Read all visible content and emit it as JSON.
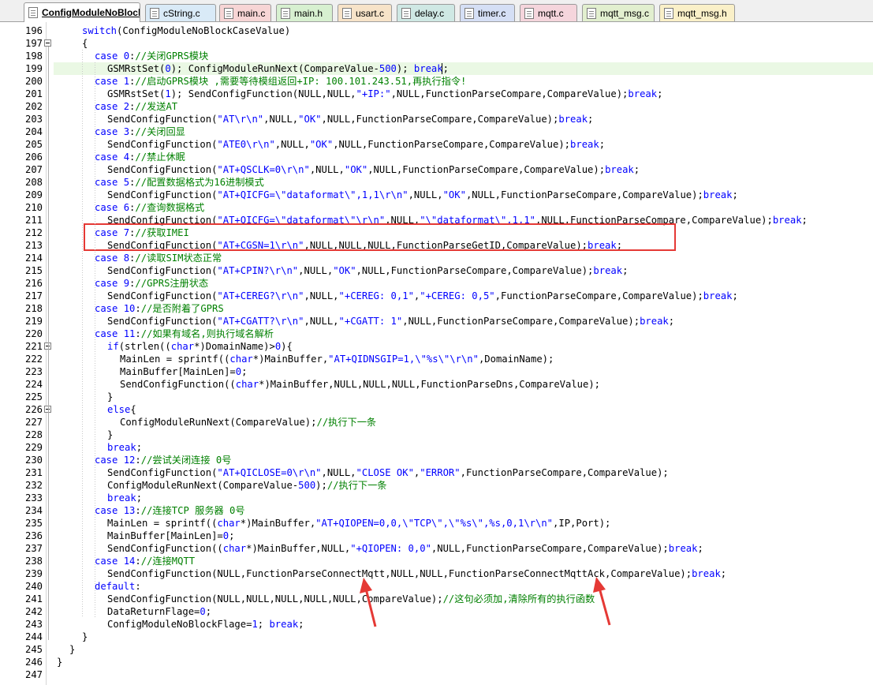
{
  "tabs": [
    {
      "label": "ConfigModuleNoBlock.c",
      "color": "#ffffff",
      "active": true
    },
    {
      "label": "cString.c",
      "color": "#d9eaf7"
    },
    {
      "label": "main.c",
      "color": "#f7d5d5"
    },
    {
      "label": "main.h",
      "color": "#d7f0d0"
    },
    {
      "label": "usart.c",
      "color": "#f7e3c8"
    },
    {
      "label": "delay.c",
      "color": "#cfe8e4"
    },
    {
      "label": "timer.c",
      "color": "#d5dff5"
    },
    {
      "label": "mqtt.c",
      "color": "#f5d5dc"
    },
    {
      "label": "mqtt_msg.c",
      "color": "#e2efcf"
    },
    {
      "label": "mqtt_msg.h",
      "color": "#faf0c8"
    }
  ],
  "line_numbers": [
    "196",
    "197",
    "198",
    "199",
    "200",
    "201",
    "202",
    "203",
    "204",
    "205",
    "206",
    "207",
    "208",
    "209",
    "210",
    "211",
    "212",
    "213",
    "214",
    "215",
    "216",
    "217",
    "218",
    "219",
    "220",
    "221",
    "222",
    "223",
    "224",
    "225",
    "226",
    "227",
    "228",
    "229",
    "230",
    "231",
    "232",
    "233",
    "234",
    "235",
    "236",
    "237",
    "238",
    "239",
    "240",
    "241",
    "242",
    "243",
    "244",
    "245",
    "246",
    "247"
  ],
  "code": [
    [
      {
        "t": "kw",
        "v": "switch"
      },
      {
        "t": "p",
        "v": "(ConfigModuleNoBlockCaseValue)"
      }
    ],
    [
      {
        "t": "p",
        "v": "{"
      }
    ],
    [
      {
        "t": "kw",
        "v": "case"
      },
      {
        "t": "p",
        "v": " "
      },
      {
        "t": "kw",
        "v": "0"
      },
      {
        "t": "p",
        "v": ":"
      },
      {
        "t": "cm",
        "v": "//关闭GPRS模块"
      }
    ],
    [
      {
        "t": "p",
        "v": "GSMRstSet("
      },
      {
        "t": "kw",
        "v": "0"
      },
      {
        "t": "p",
        "v": "); ConfigModuleRunNext(CompareValue-"
      },
      {
        "t": "kw",
        "v": "500"
      },
      {
        "t": "p",
        "v": "); "
      },
      {
        "t": "kw",
        "v": "break"
      },
      {
        "t": "p",
        "v": ";"
      }
    ],
    [
      {
        "t": "kw",
        "v": "case"
      },
      {
        "t": "p",
        "v": " "
      },
      {
        "t": "kw",
        "v": "1"
      },
      {
        "t": "p",
        "v": ":"
      },
      {
        "t": "cm",
        "v": "//启动GPRS模块 ,需要等待模组返回+IP: 100.101.243.51,再执行指令!"
      }
    ],
    [
      {
        "t": "p",
        "v": "GSMRstSet("
      },
      {
        "t": "kw",
        "v": "1"
      },
      {
        "t": "p",
        "v": "); SendConfigFunction(NULL,NULL,"
      },
      {
        "t": "str",
        "v": "\"+IP:\""
      },
      {
        "t": "p",
        "v": ",NULL,FunctionParseCompare,CompareValue);"
      },
      {
        "t": "kw",
        "v": "break"
      },
      {
        "t": "p",
        "v": ";"
      }
    ],
    [
      {
        "t": "kw",
        "v": "case"
      },
      {
        "t": "p",
        "v": " "
      },
      {
        "t": "kw",
        "v": "2"
      },
      {
        "t": "p",
        "v": ":"
      },
      {
        "t": "cm",
        "v": "//发送AT"
      }
    ],
    [
      {
        "t": "p",
        "v": "SendConfigFunction("
      },
      {
        "t": "str",
        "v": "\"AT\\r\\n\""
      },
      {
        "t": "p",
        "v": ",NULL,"
      },
      {
        "t": "str",
        "v": "\"OK\""
      },
      {
        "t": "p",
        "v": ",NULL,FunctionParseCompare,CompareValue);"
      },
      {
        "t": "kw",
        "v": "break"
      },
      {
        "t": "p",
        "v": ";"
      }
    ],
    [
      {
        "t": "kw",
        "v": "case"
      },
      {
        "t": "p",
        "v": " "
      },
      {
        "t": "kw",
        "v": "3"
      },
      {
        "t": "p",
        "v": ":"
      },
      {
        "t": "cm",
        "v": "//关闭回显"
      }
    ],
    [
      {
        "t": "p",
        "v": "SendConfigFunction("
      },
      {
        "t": "str",
        "v": "\"ATE0\\r\\n\""
      },
      {
        "t": "p",
        "v": ",NULL,"
      },
      {
        "t": "str",
        "v": "\"OK\""
      },
      {
        "t": "p",
        "v": ",NULL,FunctionParseCompare,CompareValue);"
      },
      {
        "t": "kw",
        "v": "break"
      },
      {
        "t": "p",
        "v": ";"
      }
    ],
    [
      {
        "t": "kw",
        "v": "case"
      },
      {
        "t": "p",
        "v": " "
      },
      {
        "t": "kw",
        "v": "4"
      },
      {
        "t": "p",
        "v": ":"
      },
      {
        "t": "cm",
        "v": "//禁止休眠"
      }
    ],
    [
      {
        "t": "p",
        "v": "SendConfigFunction("
      },
      {
        "t": "str",
        "v": "\"AT+QSCLK=0\\r\\n\""
      },
      {
        "t": "p",
        "v": ",NULL,"
      },
      {
        "t": "str",
        "v": "\"OK\""
      },
      {
        "t": "p",
        "v": ",NULL,FunctionParseCompare,CompareValue);"
      },
      {
        "t": "kw",
        "v": "break"
      },
      {
        "t": "p",
        "v": ";"
      }
    ],
    [
      {
        "t": "kw",
        "v": "case"
      },
      {
        "t": "p",
        "v": " "
      },
      {
        "t": "kw",
        "v": "5"
      },
      {
        "t": "p",
        "v": ":"
      },
      {
        "t": "cm",
        "v": "//配置数据格式为16进制模式"
      }
    ],
    [
      {
        "t": "p",
        "v": "SendConfigFunction("
      },
      {
        "t": "str",
        "v": "\"AT+QICFG=\\\"dataformat\\\",1,1\\r\\n\""
      },
      {
        "t": "p",
        "v": ",NULL,"
      },
      {
        "t": "str",
        "v": "\"OK\""
      },
      {
        "t": "p",
        "v": ",NULL,FunctionParseCompare,CompareValue);"
      },
      {
        "t": "kw",
        "v": "break"
      },
      {
        "t": "p",
        "v": ";"
      }
    ],
    [
      {
        "t": "kw",
        "v": "case"
      },
      {
        "t": "p",
        "v": " "
      },
      {
        "t": "kw",
        "v": "6"
      },
      {
        "t": "p",
        "v": ":"
      },
      {
        "t": "cm",
        "v": "//查询数据格式"
      }
    ],
    [
      {
        "t": "p",
        "v": "SendConfigFunction("
      },
      {
        "t": "str",
        "v": "\"AT+QICFG=\\\"dataformat\\\"\\r\\n\""
      },
      {
        "t": "p",
        "v": ",NULL,"
      },
      {
        "t": "str",
        "v": "\"\\\"dataformat\\\",1,1\""
      },
      {
        "t": "p",
        "v": ",NULL,FunctionParseCompare,CompareValue);"
      },
      {
        "t": "kw",
        "v": "break"
      },
      {
        "t": "p",
        "v": ";"
      }
    ],
    [
      {
        "t": "kw",
        "v": "case"
      },
      {
        "t": "p",
        "v": " "
      },
      {
        "t": "kw",
        "v": "7"
      },
      {
        "t": "p",
        "v": ":"
      },
      {
        "t": "cm",
        "v": "//获取IMEI"
      }
    ],
    [
      {
        "t": "p",
        "v": "SendConfigFunction("
      },
      {
        "t": "str",
        "v": "\"AT+CGSN=1\\r\\n\""
      },
      {
        "t": "p",
        "v": ",NULL,NULL,NULL,FunctionParseGetID,CompareValue);"
      },
      {
        "t": "kw",
        "v": "break"
      },
      {
        "t": "p",
        "v": ";"
      }
    ],
    [
      {
        "t": "kw",
        "v": "case"
      },
      {
        "t": "p",
        "v": " "
      },
      {
        "t": "kw",
        "v": "8"
      },
      {
        "t": "p",
        "v": ":"
      },
      {
        "t": "cm",
        "v": "//读取SIM状态正常"
      }
    ],
    [
      {
        "t": "p",
        "v": "SendConfigFunction("
      },
      {
        "t": "str",
        "v": "\"AT+CPIN?\\r\\n\""
      },
      {
        "t": "p",
        "v": ",NULL,"
      },
      {
        "t": "str",
        "v": "\"OK\""
      },
      {
        "t": "p",
        "v": ",NULL,FunctionParseCompare,CompareValue);"
      },
      {
        "t": "kw",
        "v": "break"
      },
      {
        "t": "p",
        "v": ";"
      }
    ],
    [
      {
        "t": "kw",
        "v": "case"
      },
      {
        "t": "p",
        "v": " "
      },
      {
        "t": "kw",
        "v": "9"
      },
      {
        "t": "p",
        "v": ":"
      },
      {
        "t": "cm",
        "v": "//GPRS注册状态"
      }
    ],
    [
      {
        "t": "p",
        "v": "SendConfigFunction("
      },
      {
        "t": "str",
        "v": "\"AT+CEREG?\\r\\n\""
      },
      {
        "t": "p",
        "v": ",NULL,"
      },
      {
        "t": "str",
        "v": "\"+CEREG: 0,1\""
      },
      {
        "t": "p",
        "v": ","
      },
      {
        "t": "str",
        "v": "\"+CEREG: 0,5\""
      },
      {
        "t": "p",
        "v": ",FunctionParseCompare,CompareValue);"
      },
      {
        "t": "kw",
        "v": "break"
      },
      {
        "t": "p",
        "v": ";"
      }
    ],
    [
      {
        "t": "kw",
        "v": "case"
      },
      {
        "t": "p",
        "v": " "
      },
      {
        "t": "kw",
        "v": "10"
      },
      {
        "t": "p",
        "v": ":"
      },
      {
        "t": "cm",
        "v": "//是否附着了GPRS"
      }
    ],
    [
      {
        "t": "p",
        "v": "SendConfigFunction("
      },
      {
        "t": "str",
        "v": "\"AT+CGATT?\\r\\n\""
      },
      {
        "t": "p",
        "v": ",NULL,"
      },
      {
        "t": "str",
        "v": "\"+CGATT: 1\""
      },
      {
        "t": "p",
        "v": ",NULL,FunctionParseCompare,CompareValue);"
      },
      {
        "t": "kw",
        "v": "break"
      },
      {
        "t": "p",
        "v": ";"
      }
    ],
    [
      {
        "t": "kw",
        "v": "case"
      },
      {
        "t": "p",
        "v": " "
      },
      {
        "t": "kw",
        "v": "11"
      },
      {
        "t": "p",
        "v": ":"
      },
      {
        "t": "cm",
        "v": "//如果有域名,则执行域名解析"
      }
    ],
    [
      {
        "t": "kw",
        "v": "if"
      },
      {
        "t": "p",
        "v": "(strlen(("
      },
      {
        "t": "kw",
        "v": "char"
      },
      {
        "t": "p",
        "v": "*)DomainName)>"
      },
      {
        "t": "kw",
        "v": "0"
      },
      {
        "t": "p",
        "v": "){"
      }
    ],
    [
      {
        "t": "p",
        "v": "MainLen = sprintf(("
      },
      {
        "t": "kw",
        "v": "char"
      },
      {
        "t": "p",
        "v": "*)MainBuffer,"
      },
      {
        "t": "str",
        "v": "\"AT+QIDNSGIP=1,\\\"%s\\\"\\r\\n\""
      },
      {
        "t": "p",
        "v": ",DomainName);"
      }
    ],
    [
      {
        "t": "p",
        "v": "MainBuffer[MainLen]="
      },
      {
        "t": "kw",
        "v": "0"
      },
      {
        "t": "p",
        "v": ";"
      }
    ],
    [
      {
        "t": "p",
        "v": "SendConfigFunction(("
      },
      {
        "t": "kw",
        "v": "char"
      },
      {
        "t": "p",
        "v": "*)MainBuffer,NULL,NULL,NULL,FunctionParseDns,CompareValue);"
      }
    ],
    [
      {
        "t": "p",
        "v": "}"
      }
    ],
    [
      {
        "t": "kw",
        "v": "else"
      },
      {
        "t": "p",
        "v": "{"
      }
    ],
    [
      {
        "t": "p",
        "v": "ConfigModuleRunNext(CompareValue);"
      },
      {
        "t": "cm",
        "v": "//执行下一条"
      }
    ],
    [
      {
        "t": "p",
        "v": "}"
      }
    ],
    [
      {
        "t": "kw",
        "v": "break"
      },
      {
        "t": "p",
        "v": ";"
      }
    ],
    [
      {
        "t": "kw",
        "v": "case"
      },
      {
        "t": "p",
        "v": " "
      },
      {
        "t": "kw",
        "v": "12"
      },
      {
        "t": "p",
        "v": ":"
      },
      {
        "t": "cm",
        "v": "//尝试关闭连接 0号"
      }
    ],
    [
      {
        "t": "p",
        "v": "SendConfigFunction("
      },
      {
        "t": "str",
        "v": "\"AT+QICLOSE=0\\r\\n\""
      },
      {
        "t": "p",
        "v": ",NULL,"
      },
      {
        "t": "str",
        "v": "\"CLOSE OK\""
      },
      {
        "t": "p",
        "v": ","
      },
      {
        "t": "str",
        "v": "\"ERROR\""
      },
      {
        "t": "p",
        "v": ",FunctionParseCompare,CompareValue);"
      }
    ],
    [
      {
        "t": "p",
        "v": "ConfigModuleRunNext(CompareValue-"
      },
      {
        "t": "kw",
        "v": "500"
      },
      {
        "t": "p",
        "v": ");"
      },
      {
        "t": "cm",
        "v": "//执行下一条"
      }
    ],
    [
      {
        "t": "kw",
        "v": "break"
      },
      {
        "t": "p",
        "v": ";"
      }
    ],
    [
      {
        "t": "kw",
        "v": "case"
      },
      {
        "t": "p",
        "v": " "
      },
      {
        "t": "kw",
        "v": "13"
      },
      {
        "t": "p",
        "v": ":"
      },
      {
        "t": "cm",
        "v": "//连接TCP 服务器 0号"
      }
    ],
    [
      {
        "t": "p",
        "v": "MainLen = sprintf(("
      },
      {
        "t": "kw",
        "v": "char"
      },
      {
        "t": "p",
        "v": "*)MainBuffer,"
      },
      {
        "t": "str",
        "v": "\"AT+QIOPEN=0,0,\\\"TCP\\\",\\\"%s\\\",%s,0,1\\r\\n\""
      },
      {
        "t": "p",
        "v": ",IP,Port);"
      }
    ],
    [
      {
        "t": "p",
        "v": "MainBuffer[MainLen]="
      },
      {
        "t": "kw",
        "v": "0"
      },
      {
        "t": "p",
        "v": ";"
      }
    ],
    [
      {
        "t": "p",
        "v": "SendConfigFunction(("
      },
      {
        "t": "kw",
        "v": "char"
      },
      {
        "t": "p",
        "v": "*)MainBuffer,NULL,"
      },
      {
        "t": "str",
        "v": "\"+QIOPEN: 0,0\""
      },
      {
        "t": "p",
        "v": ",NULL,FunctionParseCompare,CompareValue);"
      },
      {
        "t": "kw",
        "v": "break"
      },
      {
        "t": "p",
        "v": ";"
      }
    ],
    [
      {
        "t": "kw",
        "v": "case"
      },
      {
        "t": "p",
        "v": " "
      },
      {
        "t": "kw",
        "v": "14"
      },
      {
        "t": "p",
        "v": ":"
      },
      {
        "t": "cm",
        "v": "//连接MQTT"
      }
    ],
    [
      {
        "t": "p",
        "v": "SendConfigFunction(NULL,FunctionParseConnectMqtt,NULL,NULL,FunctionParseConnectMqttAck,CompareValue);"
      },
      {
        "t": "kw",
        "v": "break"
      },
      {
        "t": "p",
        "v": ";"
      }
    ],
    [
      {
        "t": "kw",
        "v": "default"
      },
      {
        "t": "p",
        "v": ":"
      }
    ],
    [
      {
        "t": "p",
        "v": "SendConfigFunction(NULL,NULL,NULL,NULL,NULL,CompareValue);"
      },
      {
        "t": "cm",
        "v": "//这句必须加,清除所有的执行函数"
      }
    ],
    [
      {
        "t": "p",
        "v": "DataReturnFlage="
      },
      {
        "t": "kw",
        "v": "0"
      },
      {
        "t": "p",
        "v": ";"
      }
    ],
    [
      {
        "t": "p",
        "v": "ConfigModuleNoBlockFlage="
      },
      {
        "t": "kw",
        "v": "1"
      },
      {
        "t": "p",
        "v": "; "
      },
      {
        "t": "kw",
        "v": "break"
      },
      {
        "t": "p",
        "v": ";"
      }
    ],
    [
      {
        "t": "p",
        "v": "}"
      }
    ],
    [
      {
        "t": "p",
        "v": "}"
      }
    ],
    [
      {
        "t": "p",
        "v": "}"
      }
    ],
    []
  ],
  "annotation_color": "#e53935"
}
